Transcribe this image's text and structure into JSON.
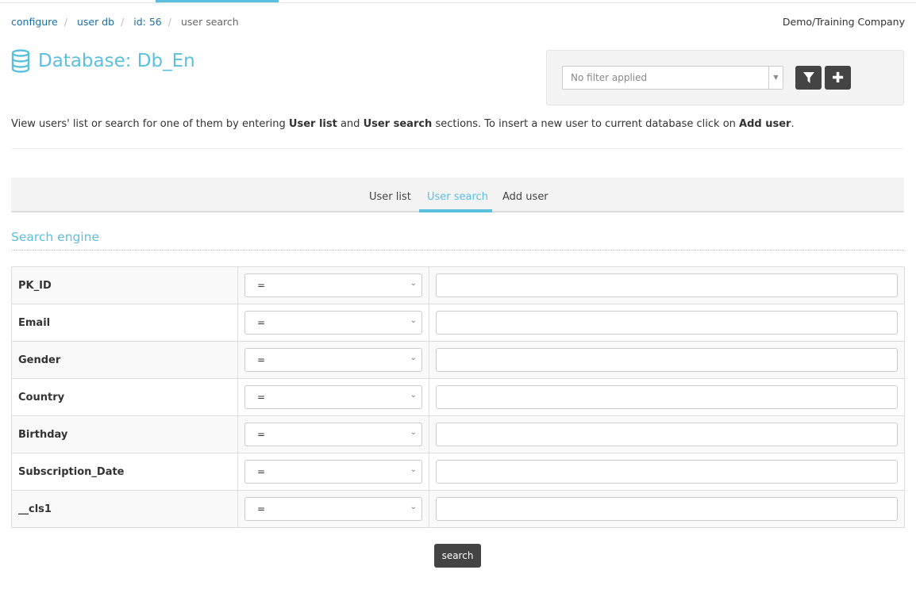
{
  "breadcrumb": [
    "configure",
    "user db",
    "id: 56",
    "user search"
  ],
  "company": "Demo/Training Company",
  "page_title": "Database: Db_En",
  "filter": {
    "placeholder": "No filter applied",
    "filter_icon": "filter-icon",
    "add_icon": "plus-icon"
  },
  "description": {
    "p1": "View users' list or search for one of them by entering ",
    "b1": "User list",
    "p2": " and ",
    "b2": "User search",
    "p3": " sections. To insert a new user to current database click on ",
    "b3": "Add user",
    "p4": "."
  },
  "tabs": [
    {
      "label": "User list"
    },
    {
      "label": "User search",
      "active": true
    },
    {
      "label": "Add user"
    }
  ],
  "section_title": "Search engine",
  "fields": [
    {
      "label": "PK_ID",
      "operator": "=",
      "value": ""
    },
    {
      "label": "Email",
      "operator": "=",
      "value": ""
    },
    {
      "label": "Gender",
      "operator": "=",
      "value": ""
    },
    {
      "label": "Country",
      "operator": "=",
      "value": ""
    },
    {
      "label": "Birthday",
      "operator": "=",
      "value": ""
    },
    {
      "label": "Subscription_Date",
      "operator": "=",
      "value": ""
    },
    {
      "label": "__cls1",
      "operator": "=",
      "value": ""
    }
  ],
  "search_label": "search",
  "colors": {
    "accent": "#5bc0de",
    "link": "#1a6ea8",
    "button": "#444444"
  }
}
